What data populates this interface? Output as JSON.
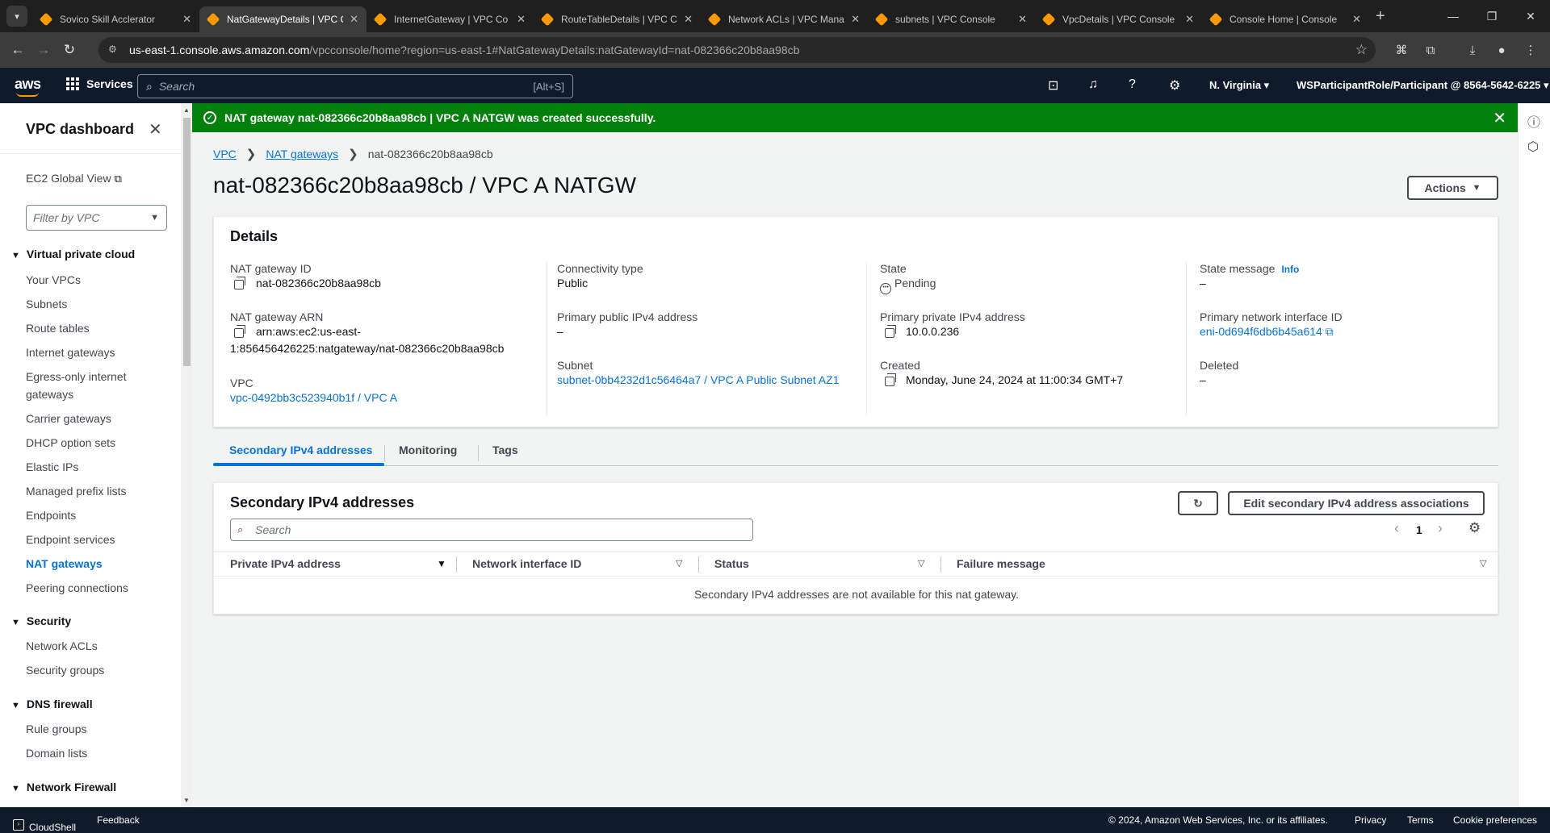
{
  "browser": {
    "tabs": [
      {
        "title": "Sovico Skill Acclerator"
      },
      {
        "title": "NatGatewayDetails | VPC C"
      },
      {
        "title": "InternetGateway | VPC Co"
      },
      {
        "title": "RouteTableDetails | VPC C"
      },
      {
        "title": "Network ACLs | VPC Mana"
      },
      {
        "title": "subnets | VPC Console"
      },
      {
        "title": "VpcDetails | VPC Console"
      },
      {
        "title": "Console Home | Console"
      }
    ],
    "url_host": "us-east-1.console.aws.amazon.com",
    "url_path": "/vpcconsole/home?region=us-east-1#NatGatewayDetails:natGatewayId=nat-082366c20b8aa98cb"
  },
  "aws_nav": {
    "logo": "aws",
    "services_label": "Services",
    "search_placeholder": "Search",
    "search_shortcut": "[Alt+S]",
    "region": "N. Virginia",
    "account": "WSParticipantRole/Participant @ 8564-5642-6225"
  },
  "sidebar": {
    "title": "VPC dashboard",
    "ec2_global_view": "EC2 Global View",
    "filter_placeholder": "Filter by VPC",
    "sections": {
      "virtual_private_cloud": "Virtual private cloud",
      "security": "Security",
      "dns_firewall": "DNS firewall",
      "network_firewall": "Network Firewall"
    },
    "vpc_items": [
      "Your VPCs",
      "Subnets",
      "Route tables",
      "Internet gateways",
      "Egress-only internet gateways",
      "Carrier gateways",
      "DHCP option sets",
      "Elastic IPs",
      "Managed prefix lists",
      "Endpoints",
      "Endpoint services",
      "NAT gateways",
      "Peering connections"
    ],
    "security_items": [
      "Network ACLs",
      "Security groups"
    ],
    "dns_items": [
      "Rule groups",
      "Domain lists"
    ]
  },
  "flash": {
    "message": "NAT gateway nat-082366c20b8aa98cb | VPC A NATGW was created successfully."
  },
  "breadcrumb": {
    "root": "VPC",
    "parent": "NAT gateways",
    "current": "nat-082366c20b8aa98cb"
  },
  "page": {
    "title": "nat-082366c20b8aa98cb / VPC A NATGW",
    "actions_label": "Actions"
  },
  "details": {
    "heading": "Details",
    "nat_id_label": "NAT gateway ID",
    "nat_id": "nat-082366c20b8aa98cb",
    "nat_arn_label": "NAT gateway ARN",
    "nat_arn_line1": "arn:aws:ec2:us-east-",
    "nat_arn_line2": "1:856456426225:natgateway/nat-082366c20b8aa98cb",
    "vpc_label": "VPC",
    "vpc": "vpc-0492bb3c523940b1f / VPC A",
    "connectivity_label": "Connectivity type",
    "connectivity": "Public",
    "public_ip_label": "Primary public IPv4 address",
    "public_ip": "–",
    "subnet_label": "Subnet",
    "subnet": "subnet-0bb4232d1c56464a7 / VPC A Public Subnet AZ1",
    "state_label": "State",
    "state": "Pending",
    "private_ip_label": "Primary private IPv4 address",
    "private_ip": "10.0.0.236",
    "created_label": "Created",
    "created": "Monday, June 24, 2024 at 11:00:34 GMT+7",
    "state_message_label": "State message",
    "info_label": "Info",
    "state_message": "–",
    "eni_label": "Primary network interface ID",
    "eni": "eni-0d694f6db6b45a614",
    "deleted_label": "Deleted",
    "deleted": "–"
  },
  "tabs": [
    "Secondary IPv4 addresses",
    "Monitoring",
    "Tags"
  ],
  "secondary": {
    "heading": "Secondary IPv4 addresses",
    "edit_label": "Edit secondary IPv4 address associations",
    "search_placeholder": "Search",
    "page_number": "1",
    "columns": [
      "Private IPv4 address",
      "Network interface ID",
      "Status",
      "Failure message"
    ],
    "empty_message": "Secondary IPv4 addresses are not available for this nat gateway."
  },
  "footer": {
    "cloudshell": "CloudShell",
    "feedback": "Feedback",
    "copyright": "© 2024, Amazon Web Services, Inc. or its affiliates.",
    "privacy": "Privacy",
    "terms": "Terms",
    "cookies": "Cookie preferences"
  },
  "colors": {
    "success": "#037f0c",
    "link": "#0972d3",
    "nav_bg": "#0f1b2a",
    "aws_orange": "#ff9900"
  }
}
